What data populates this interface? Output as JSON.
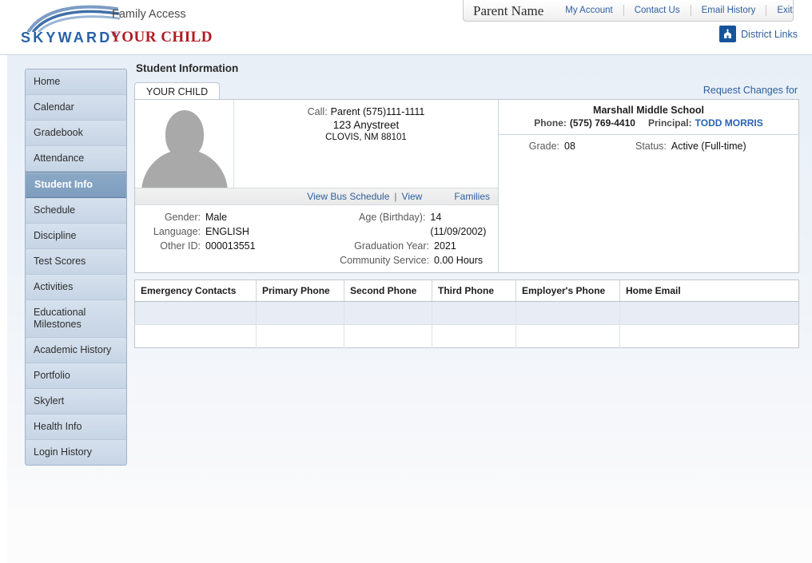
{
  "brand": {
    "logo_text": "SKYWARD",
    "logo_registered": "®",
    "product": "Family Access",
    "student_name": "YOUR CHILD",
    "logo_color": "#2761a8",
    "student_name_color": "#b01c24"
  },
  "topnav": {
    "parent_name": "Parent Name",
    "links": [
      {
        "label": "My Account",
        "name": "my-account"
      },
      {
        "label": "Contact Us",
        "name": "contact-us"
      },
      {
        "label": "Email History",
        "name": "email-history"
      },
      {
        "label": "Exit",
        "name": "exit"
      }
    ],
    "district_links_label": "District Links",
    "district_links_icon": "school-building-icon",
    "district_links_icon_color": "#15549a"
  },
  "sidebar": {
    "active_index": 4,
    "items": [
      {
        "label": "Home"
      },
      {
        "label": "Calendar"
      },
      {
        "label": "Gradebook"
      },
      {
        "label": "Attendance"
      },
      {
        "label": "Student Info"
      },
      {
        "label": "Schedule"
      },
      {
        "label": "Discipline"
      },
      {
        "label": "Test Scores"
      },
      {
        "label": "Activities"
      },
      {
        "label": "Educational Milestones"
      },
      {
        "label": "Academic History"
      },
      {
        "label": "Portfolio"
      },
      {
        "label": "Skylert"
      },
      {
        "label": "Health Info"
      },
      {
        "label": "Login History"
      }
    ]
  },
  "main": {
    "page_title": "Student Information",
    "request_changes_label": "Request Changes for",
    "tab_label": "YOUR CHILD",
    "photo_alt": "student-photo-placeholder",
    "address": {
      "call_label": "Call:",
      "call_value": "Parent (575)111-1111",
      "street": "123 Anystreet",
      "city_state_zip": "CLOVIS, NM 88101"
    },
    "links_bar": {
      "view_bus_schedule": "View Bus Schedule",
      "separator": "|",
      "view": "View",
      "families": "Families"
    },
    "demographics_left": [
      {
        "key": "Gender:",
        "value": "Male"
      },
      {
        "key": "Language:",
        "value": "ENGLISH"
      },
      {
        "key": "Other ID:",
        "value": "000013551"
      }
    ],
    "demographics_right": [
      {
        "key": "Age (Birthday):",
        "value": "14 (11/09/2002)"
      },
      {
        "key": "Graduation Year:",
        "value": "2021"
      },
      {
        "key": "Community Service:",
        "value": "0.00 Hours"
      }
    ],
    "school": {
      "name": "Marshall Middle School",
      "phone_label": "Phone:",
      "phone_value": "(575) 769-4410",
      "principal_label": "Principal:",
      "principal_name": "TODD MORRIS",
      "grade_label": "Grade:",
      "grade_value": "08",
      "status_label": "Status:",
      "status_value": "Active (Full-time)"
    },
    "contacts_table": {
      "columns": [
        "Emergency Contacts",
        "Primary Phone",
        "Second Phone",
        "Third Phone",
        "Employer's Phone",
        "Home Email"
      ],
      "rows": [
        [
          "",
          "",
          "",
          "",
          "",
          ""
        ],
        [
          "",
          "",
          "",
          "",
          "",
          ""
        ]
      ]
    }
  }
}
